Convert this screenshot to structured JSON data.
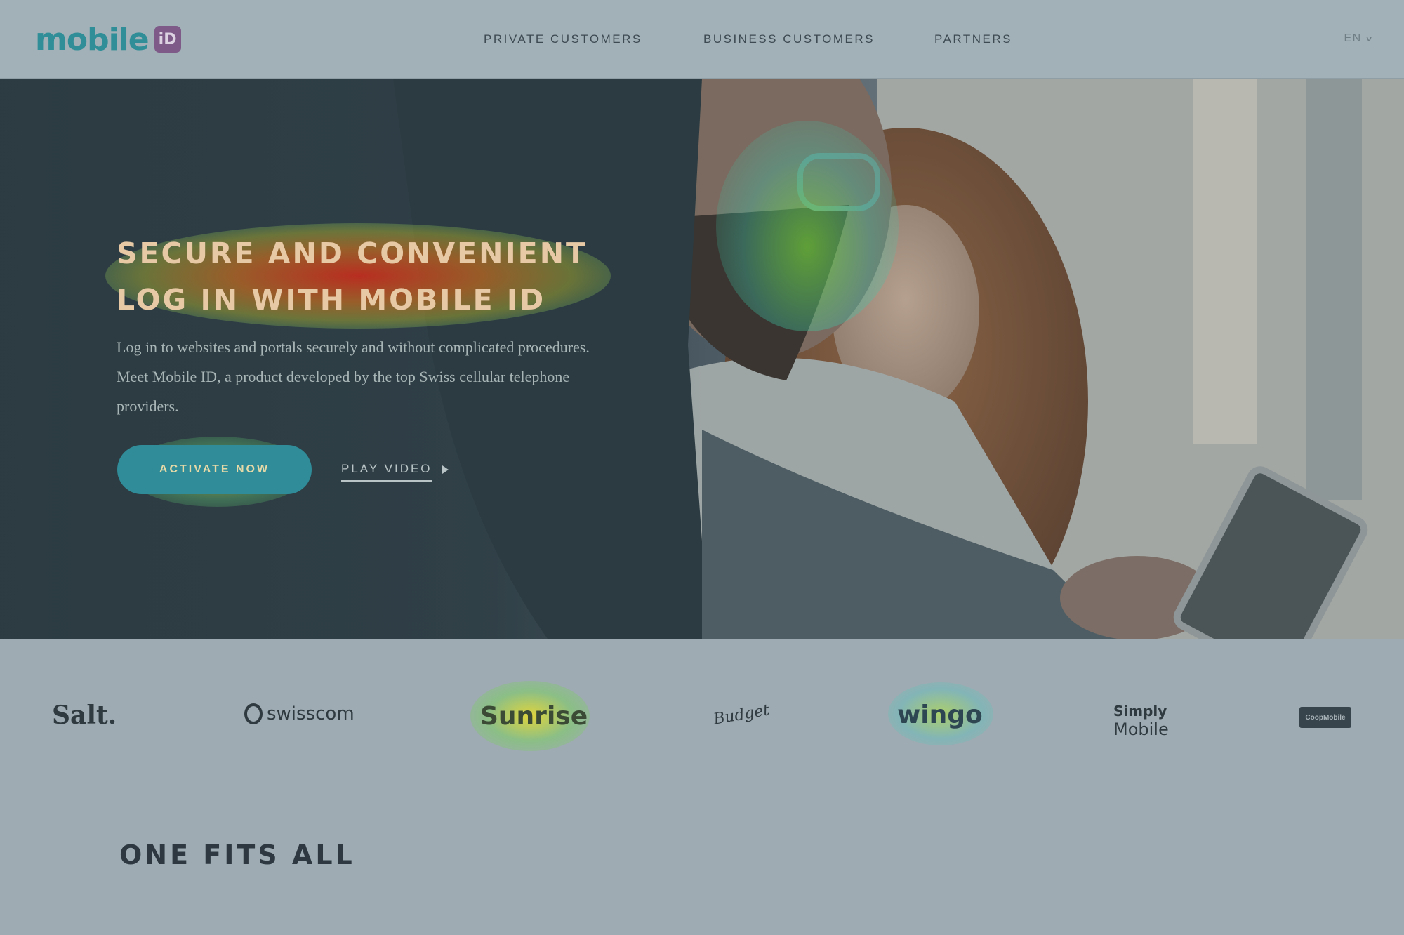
{
  "header": {
    "logo_text": "mobile",
    "logo_badge": "iD",
    "nav": [
      {
        "label": "PRIVATE CUSTOMERS"
      },
      {
        "label": "BUSINESS CUSTOMERS"
      },
      {
        "label": "PARTNERS"
      }
    ],
    "language": "EN"
  },
  "hero": {
    "title_line1": "SECURE AND CONVENIENT",
    "title_line2": "LOG IN WITH MOBILE ID",
    "description": "Log in to websites and portals securely and without complicated procedures. Meet Mobile ID, a product developed by the top Swiss cellular telephone providers.",
    "cta_label": "ACTIVATE NOW",
    "video_label": "PLAY VIDEO"
  },
  "partners": [
    {
      "name": "Salt."
    },
    {
      "name": "swisscom"
    },
    {
      "name": "Sunrise"
    },
    {
      "name": "Budget"
    },
    {
      "name": "wingo"
    },
    {
      "name": "Simply",
      "name2": "Mobile"
    },
    {
      "name": "CoopMobile"
    }
  ],
  "section": {
    "title": "ONE FITS ALL"
  },
  "colors": {
    "accent": "#2f8c98",
    "logo_purple": "#7d5a88",
    "page_bg": "#9eabb2"
  }
}
